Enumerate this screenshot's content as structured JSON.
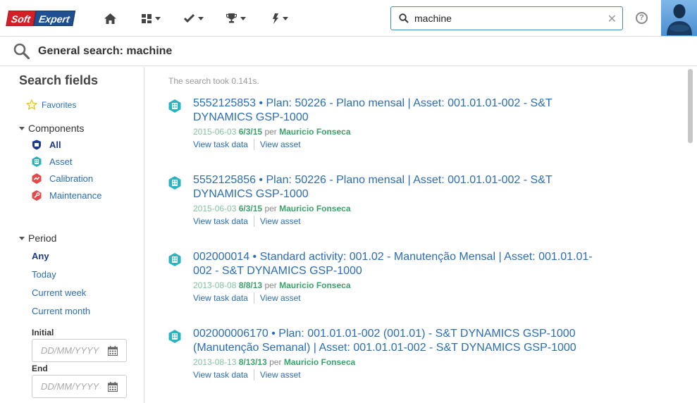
{
  "app": {
    "logo_part1": "Soft",
    "logo_part2": "Expert"
  },
  "nav": {
    "items": [
      {
        "name": "home-icon"
      },
      {
        "name": "dashboard-icon"
      },
      {
        "name": "check-icon"
      },
      {
        "name": "trophy-icon"
      },
      {
        "name": "lightning-icon"
      }
    ]
  },
  "search": {
    "value": "machine",
    "clear_icon": "close-icon"
  },
  "help_label": "?",
  "page": {
    "title": "General search: machine"
  },
  "sidebar": {
    "title": "Search fields",
    "favorites": "Favorites",
    "components_header": "Components",
    "components": [
      {
        "label": "All",
        "icon": "shield-icon",
        "color": "#1d3a8a"
      },
      {
        "label": "Asset",
        "icon": "building-icon",
        "color": "#2bb3c0"
      },
      {
        "label": "Calibration",
        "icon": "calibration-icon",
        "color": "#e04a4a"
      },
      {
        "label": "Maintenance",
        "icon": "maintenance-icon",
        "color": "#e04a4a"
      }
    ],
    "period_header": "Period",
    "periods": [
      "Any",
      "Today",
      "Current week",
      "Current month"
    ],
    "initial_label": "Initial",
    "end_label": "End",
    "date_placeholder": "DD/MM/YYYY"
  },
  "results": {
    "took": "The search took 0.141s.",
    "items": [
      {
        "title_line1": "5552125853 • Plan: 50226 - Plano mensal | Asset: 001.01.01-002 - S&T",
        "title_line2": "DYNAMICS GSP-1000",
        "date_iso": "2015-06-03",
        "date_short": "6/3/15",
        "per": "per",
        "author": "Mauricio Fonseca",
        "action1": "View task data",
        "action2": "View asset"
      },
      {
        "title_line1": "5552125856 • Plan: 50226 - Plano mensal | Asset: 001.01.01-002 - S&T",
        "title_line2": "DYNAMICS GSP-1000",
        "date_iso": "2015-06-03",
        "date_short": "6/3/15",
        "per": "per",
        "author": "Mauricio Fonseca",
        "action1": "View task data",
        "action2": "View asset"
      },
      {
        "title_line1": "002000014 • Standard activity: 001.02 - Manutenção Mensal | Asset: 001.01.01-",
        "title_line2": "002 - S&T DYNAMICS GSP-1000",
        "date_iso": "2013-08-08",
        "date_short": "8/8/13",
        "per": "per",
        "author": "Mauricio Fonseca",
        "action1": "View task data",
        "action2": "View asset"
      },
      {
        "title_line1": "002000006170 • Plan: 001.01.01-002 (001.01) - S&T DYNAMICS GSP-1000",
        "title_line2": "(Manutenção Semanal) | Asset: 001.01.01-002 - S&T DYNAMICS GSP-1000",
        "date_iso": "2013-08-13",
        "date_short": "8/13/13",
        "per": "per",
        "author": "Mauricio Fonseca",
        "action1": "View task data",
        "action2": "View asset"
      }
    ]
  },
  "colors": {
    "link": "#2a6db5",
    "meta_green": "#3aa36b",
    "asset_icon": "#2bb3c0",
    "search_border": "#3e8fbf"
  }
}
